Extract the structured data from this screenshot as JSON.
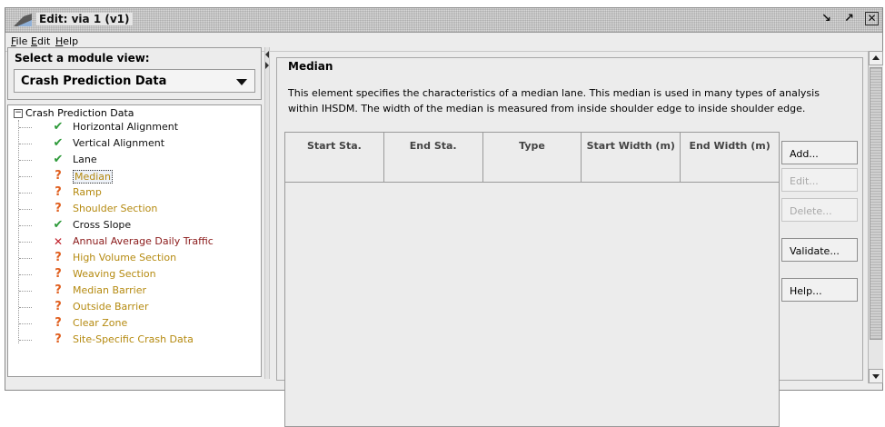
{
  "window": {
    "title": "Edit: via 1 (v1)"
  },
  "menubar": {
    "items": [
      "File",
      "Edit",
      "Help"
    ]
  },
  "module_view": {
    "label": "Select a module view:",
    "selected": "Crash Prediction Data"
  },
  "tree": {
    "root": "Crash Prediction Data",
    "items": [
      {
        "label": "Horizontal Alignment",
        "status": "ok"
      },
      {
        "label": "Vertical Alignment",
        "status": "ok"
      },
      {
        "label": "Lane",
        "status": "ok"
      },
      {
        "label": "Median",
        "status": "warn",
        "selected": true
      },
      {
        "label": "Ramp",
        "status": "warn"
      },
      {
        "label": "Shoulder Section",
        "status": "warn"
      },
      {
        "label": "Cross Slope",
        "status": "ok"
      },
      {
        "label": "Annual Average Daily Traffic",
        "status": "err"
      },
      {
        "label": "High Volume Section",
        "status": "warn"
      },
      {
        "label": "Weaving Section",
        "status": "warn"
      },
      {
        "label": "Median Barrier",
        "status": "warn"
      },
      {
        "label": "Outside Barrier",
        "status": "warn"
      },
      {
        "label": "Clear Zone",
        "status": "warn"
      },
      {
        "label": "Site-Specific Crash Data",
        "status": "warn"
      }
    ]
  },
  "panel": {
    "title": "Median",
    "description": "This element specifies the characteristics of a median lane. This median is used in many types of analysis within IHSDM. The width of the median is measured from inside shoulder edge to inside shoulder edge.",
    "columns": [
      "Start Sta.",
      "End Sta.",
      "Type",
      "Start Width (m)",
      "End Width (m)"
    ],
    "buttons": {
      "add": "Add...",
      "edit": "Edit...",
      "delete": "Delete...",
      "validate": "Validate...",
      "help": "Help..."
    }
  },
  "colors": {
    "ok": "#2e9a3a",
    "warn": "#e06020",
    "err": "#c0202a"
  }
}
